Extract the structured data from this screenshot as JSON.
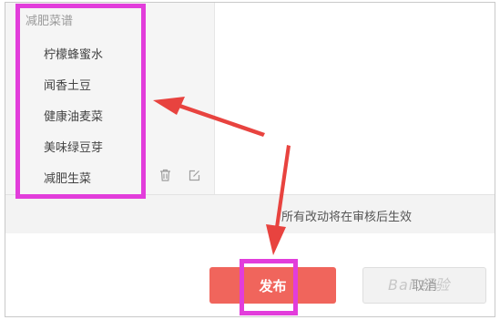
{
  "menu": {
    "title": "减肥菜谱",
    "items": [
      {
        "label": "柠檬蜂蜜水"
      },
      {
        "label": "闻香土豆"
      },
      {
        "label": "健康油麦菜"
      },
      {
        "label": "美味绿豆芽"
      },
      {
        "label": "减肥生菜"
      }
    ]
  },
  "notice": {
    "text": "所有改动将在审核后生效"
  },
  "buttons": {
    "publish_label": "发布",
    "cancel_label": "取消"
  },
  "icons": {
    "trash": "trash-icon",
    "edit": "edit-icon"
  },
  "colors": {
    "highlight": "#e23ddb",
    "arrow": "#e8433f",
    "publish_button": "#f0655c",
    "panel_background": "#f5f5f5"
  },
  "watermark": {
    "text": "Bai 经验"
  }
}
